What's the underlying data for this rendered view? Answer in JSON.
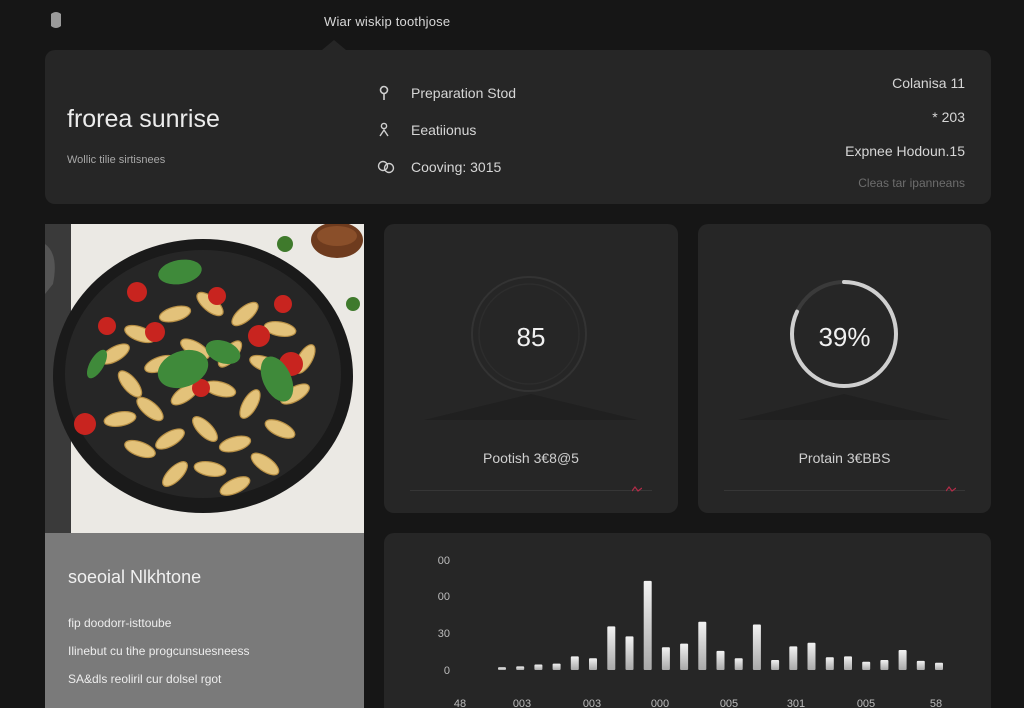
{
  "topbar": {
    "title": "Wiar wiskip toothjose"
  },
  "header": {
    "recipe_name": "frorea sunrise",
    "recipe_sub": "Wollic tilie sirtisnees",
    "meta": [
      {
        "icon": "location-pin-icon",
        "text": "Preparation Stod"
      },
      {
        "icon": "person-icon",
        "text": "Eeatiionus"
      },
      {
        "icon": "servings-icon",
        "text": "Cooving: 3015"
      }
    ],
    "right": {
      "calories": "Colanisa 11",
      "percent": "* 203",
      "expense": "Expnee Hodoun.15",
      "note": "Cleas tar ipanneans"
    }
  },
  "social": {
    "title": "soeoial Nlkhtone",
    "lines": [
      "fip doodorr-isttoube",
      "Ilinebut cu tihe progcunsuesneess",
      "SA&dls reoliril cur dolsel rgot"
    ]
  },
  "stats": [
    {
      "value": "85",
      "label": "Pootish 3€8@5",
      "percent": 0
    },
    {
      "value": "39%",
      "label": "Protain 3€BBS",
      "percent": 82
    }
  ],
  "chart_data": {
    "type": "bar",
    "y_ticks": [
      "00",
      "00",
      "30",
      "0"
    ],
    "x_ticks": [
      "48",
      "003",
      "003",
      "000",
      "005",
      "301",
      "005",
      "58"
    ],
    "ylim": [
      0,
      110
    ],
    "values": [
      3,
      4,
      6,
      7,
      15,
      13,
      48,
      37,
      98,
      25,
      29,
      53,
      21,
      13,
      50,
      11,
      26,
      30,
      14,
      15,
      9,
      11,
      22,
      10,
      8
    ],
    "colors": {
      "bar_top": "#f2f2f2",
      "bar_bottom": "#a9a9a9",
      "accent": "#b12c48"
    }
  }
}
